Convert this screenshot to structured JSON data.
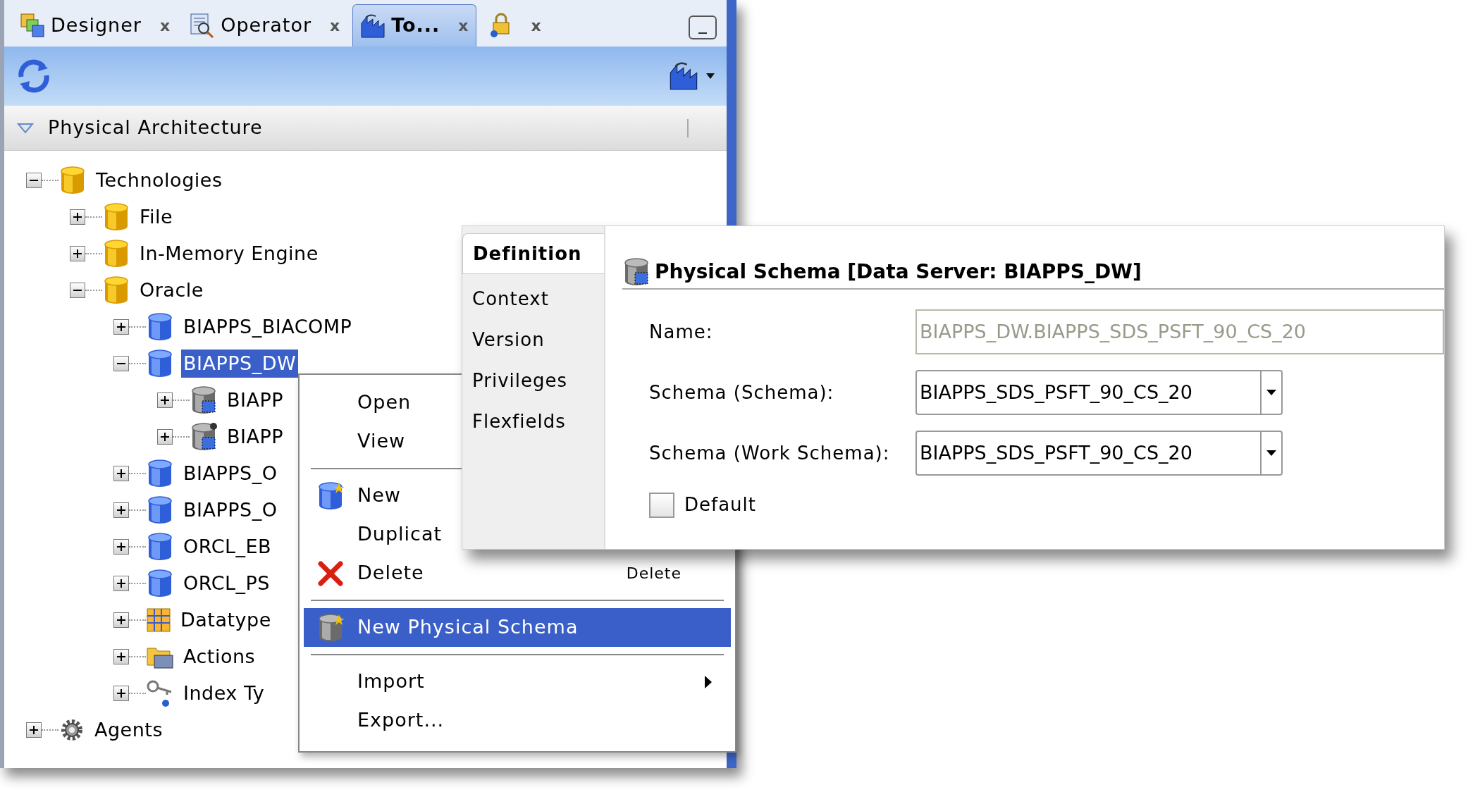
{
  "tabs": [
    {
      "kind": "designer",
      "label": "Designer",
      "close": "x",
      "selected": false
    },
    {
      "kind": "operator",
      "label": "Operator",
      "close": "x",
      "selected": false
    },
    {
      "kind": "topology",
      "label": "To...",
      "close": "x",
      "selected": true
    },
    {
      "kind": "security",
      "close": "x",
      "selected": false
    }
  ],
  "section": {
    "title": "Physical Architecture",
    "expanded": true
  },
  "tree": [
    {
      "kind": "technology",
      "label": "Technologies",
      "expanded": true,
      "selected": false,
      "children": [
        {
          "kind": "technology",
          "label": "File",
          "expanded": false,
          "selected": false
        },
        {
          "kind": "technology",
          "label": "In-Memory Engine",
          "expanded": false,
          "selected": false
        },
        {
          "kind": "technology",
          "label": "Oracle",
          "expanded": true,
          "selected": false,
          "children": [
            {
              "kind": "server",
              "label": "BIAPPS_BIACOMP",
              "expanded": false,
              "selected": false
            },
            {
              "kind": "server",
              "label": "BIAPPS_DW",
              "expanded": true,
              "selected": true,
              "children": [
                {
                  "kind": "schema",
                  "label": "BIAPP",
                  "expanded": false,
                  "selected": false
                },
                {
                  "kind": "default-schema",
                  "label": "BIAPP",
                  "expanded": false,
                  "selected": false
                }
              ]
            },
            {
              "kind": "server",
              "label": "BIAPPS_O",
              "expanded": false,
              "selected": false
            },
            {
              "kind": "server",
              "label": "BIAPPS_O",
              "expanded": false,
              "selected": false
            },
            {
              "kind": "server",
              "label": "ORCL_EB",
              "expanded": false,
              "selected": false
            },
            {
              "kind": "server",
              "label": "ORCL_PS",
              "expanded": false,
              "selected": false
            },
            {
              "kind": "datatypes",
              "label": "Datatype",
              "expanded": false,
              "selected": false
            },
            {
              "kind": "actions",
              "label": "Actions",
              "expanded": false,
              "selected": false
            },
            {
              "kind": "index",
              "label": "Index Ty",
              "expanded": false,
              "selected": false
            }
          ]
        }
      ]
    },
    {
      "kind": "agents",
      "label": "Agents",
      "expanded": false,
      "selected": false
    }
  ],
  "context_menu": [
    {
      "kind": "plain",
      "label": "Open",
      "selected": false
    },
    {
      "kind": "plain",
      "label": "View",
      "selected": false
    },
    {
      "kind": "separator"
    },
    {
      "kind": "create",
      "label": "New",
      "selected": false
    },
    {
      "kind": "plain",
      "label": "Duplicat",
      "selected": false
    },
    {
      "kind": "delete",
      "label": "Delete",
      "shortcut": "Delete",
      "selected": false
    },
    {
      "kind": "separator"
    },
    {
      "kind": "create-schema",
      "label": "New Physical Schema",
      "selected": true
    },
    {
      "kind": "separator"
    },
    {
      "kind": "submenu",
      "label": "Import",
      "selected": false
    },
    {
      "kind": "plain",
      "label": "Export...",
      "selected": false
    }
  ],
  "dialog": {
    "tabs": [
      {
        "label": "Definition",
        "selected": true
      },
      {
        "label": "Context",
        "selected": false
      },
      {
        "label": "Version",
        "selected": false
      },
      {
        "label": "Privileges",
        "selected": false
      },
      {
        "label": "Flexfields",
        "selected": false
      }
    ],
    "title": "Physical Schema [Data Server: BIAPPS_DW]",
    "fields": [
      {
        "kind": "text",
        "label": "Name:",
        "value": "BIAPPS_DW.BIAPPS_SDS_PSFT_90_CS_20",
        "disabled": true
      },
      {
        "kind": "select",
        "label": "Schema (Schema):",
        "value": "BIAPPS_SDS_PSFT_90_CS_20"
      },
      {
        "kind": "select",
        "label": "Schema (Work Schema):",
        "value": "BIAPPS_SDS_PSFT_90_CS_20"
      }
    ],
    "default": {
      "label": "Default",
      "checked": false
    }
  }
}
